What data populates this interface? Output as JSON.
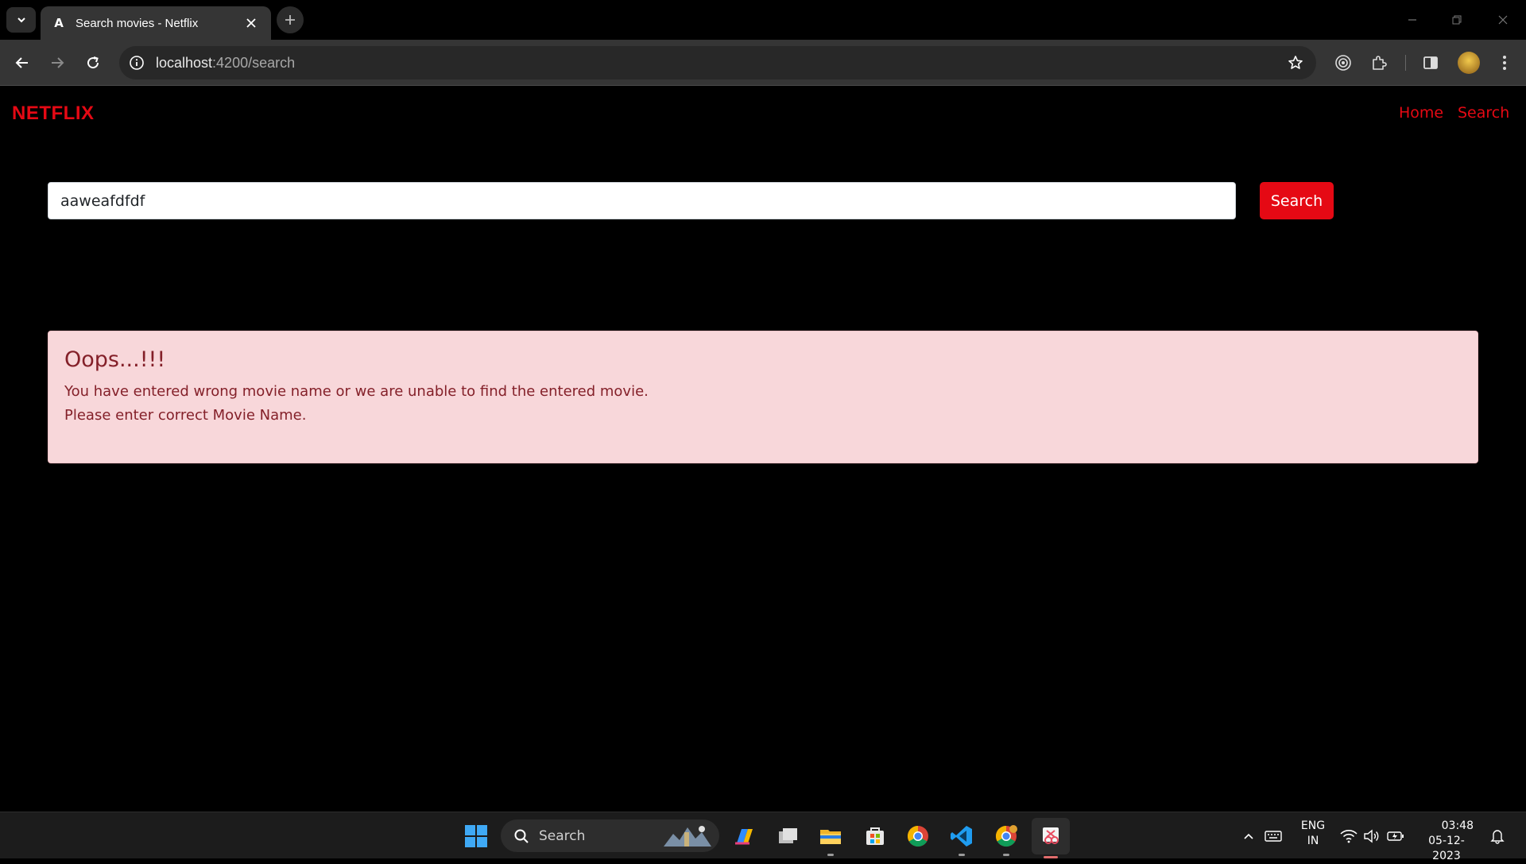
{
  "browser": {
    "tab_title": "Search movies - Netflix",
    "url_host": "localhost",
    "url_path": ":4200/search"
  },
  "app": {
    "brand": "NETFLIX",
    "nav": [
      "Home",
      "Search"
    ],
    "accent_color": "#e50914"
  },
  "search": {
    "value": "aaweafdfdf",
    "button_label": "Search"
  },
  "alert": {
    "title": "Oops...!!!",
    "line1": "You have entered wrong movie name or we are unable to find the entered movie.",
    "line2": "Please enter correct Movie Name."
  },
  "taskbar": {
    "search_label": "Search",
    "language": "ENG",
    "region": "IN",
    "time": "03:48",
    "date": "05-12-2023"
  }
}
